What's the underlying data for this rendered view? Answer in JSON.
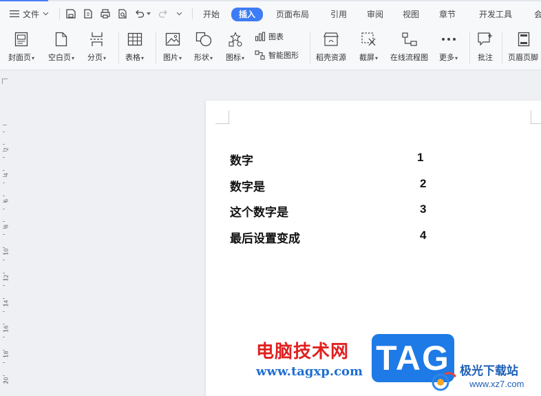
{
  "topbar": {
    "menu_label": "文件",
    "tabs": [
      {
        "label": "开始"
      },
      {
        "label": "插入"
      },
      {
        "label": "页面布局"
      },
      {
        "label": "引用"
      },
      {
        "label": "审阅"
      },
      {
        "label": "视图"
      },
      {
        "label": "章节"
      },
      {
        "label": "开发工具"
      },
      {
        "label": "会"
      }
    ],
    "active_tab": "插入"
  },
  "ribbon": {
    "cover": "封面页",
    "blank": "空白页",
    "pagebreak": "分页",
    "table": "表格",
    "picture": "图片",
    "shape": "形状",
    "icon": "图标",
    "chart": "图表",
    "smartart": "智能图形",
    "resources": "稻壳资源",
    "screenshot": "截屏",
    "flowchart": "在线流程图",
    "more": "更多",
    "comment": "批注",
    "headerfooter": "页眉页脚"
  },
  "ruler": {
    "numbers": [
      "2",
      "4",
      "6",
      "8",
      "10",
      "12",
      "14",
      "16",
      "18",
      "20"
    ]
  },
  "document": {
    "rows": [
      {
        "label": "数字",
        "number": "1"
      },
      {
        "label": "数字是",
        "number": "2"
      },
      {
        "label": "这个数字是",
        "number": "3"
      },
      {
        "label": "最后设置变成",
        "number": "4"
      }
    ]
  },
  "watermark": {
    "site_name": "电脑技术网",
    "site_url": "www.tagxp.com",
    "tag_text": "TAG",
    "partner_name": "极光下载站",
    "partner_url": "www.xz7.com"
  },
  "colors": {
    "accent": "#3d7cf4",
    "watermark_red": "#e02020",
    "watermark_blue": "#1e7ae6"
  }
}
